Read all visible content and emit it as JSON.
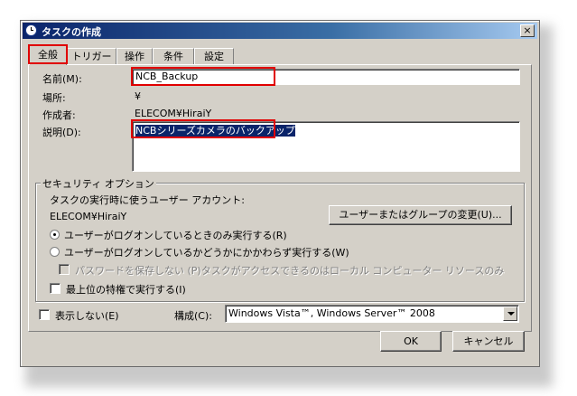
{
  "window": {
    "title": "タスクの作成",
    "close_glyph": "×"
  },
  "tabs": [
    {
      "label": "全般",
      "active": true
    },
    {
      "label": "トリガー"
    },
    {
      "label": "操作"
    },
    {
      "label": "条件"
    },
    {
      "label": "設定"
    }
  ],
  "general": {
    "name_label": "名前(M):",
    "name_value": "NCB_Backup",
    "location_label": "場所:",
    "location_value": "¥",
    "author_label": "作成者:",
    "author_value": "ELECOM¥HiraiY",
    "description_label": "説明(D):",
    "description_value": "NCBシリーズカメラのバックアップ"
  },
  "security": {
    "group_title": "セキュリティ オプション",
    "account_prompt": "タスクの実行時に使うユーザー アカウント:",
    "account_value": "ELECOM¥HiraiY",
    "change_user_button": "ユーザーまたはグループの変更(U)...",
    "radio_logged_on": "ユーザーがログオンしているときのみ実行する(R)",
    "radio_whether": "ユーザーがログオンしているかどうかにかかわらず実行する(W)",
    "no_store_password": "パスワードを保存しない (P)タスクがアクセスできるのはローカル コンピューター リソースのみ",
    "highest_privileges": "最上位の特権で実行する(I)",
    "selected_radio": "logged_on"
  },
  "footer": {
    "hidden_label": "表示しない(E)",
    "configure_label": "構成(C):",
    "configure_value": "Windows Vista™, Windows Server™ 2008",
    "ok_button": "OK",
    "cancel_button": "キャンセル"
  },
  "colors": {
    "highlight_border": "#e00000",
    "selection_bg": "#0a246a",
    "dialog_bg": "#d4d0c8"
  }
}
